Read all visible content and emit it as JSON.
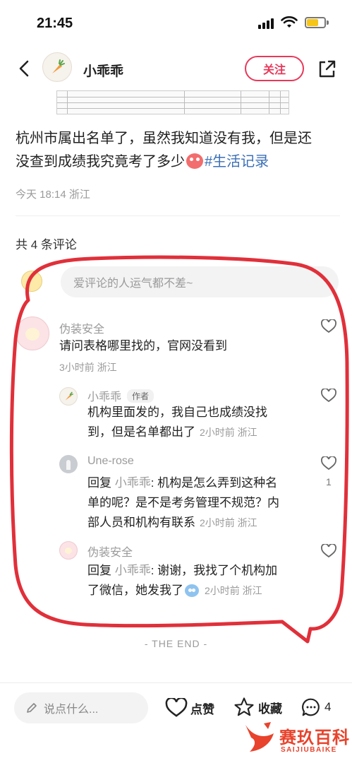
{
  "status_bar": {
    "time": "21:45"
  },
  "header": {
    "author_name": "小乖乖",
    "follow_label": "关注"
  },
  "post": {
    "text_line1": "杭州市属出名单了，虽然我知道没有我，但是还",
    "text_line2": "没查到成绩我究竟考了多少",
    "hashtag": "#生活记录",
    "meta": "今天 18:14 浙江"
  },
  "comments_section": {
    "count_label": "共 4 条评论",
    "input_placeholder": "爱评论的人运气都不差~"
  },
  "comments": [
    {
      "name": "伪装安全",
      "text": "请问表格哪里找的，官网没看到",
      "meta": "3小时前 浙江"
    },
    {
      "name": "小乖乖",
      "badge": "作者",
      "text_line1": "机构里面发的，我自己也成绩没找",
      "text_line2": "到，但是名单都出了",
      "meta": "2小时前 浙江"
    },
    {
      "name": "Une-rose",
      "reply_prefix": "回复 ",
      "reply_to": "小乖乖",
      "text_line1": ": 机构是怎么弄到这种名",
      "text_line2": "单的呢？是不是考务管理不规范？内",
      "text_line3": "部人员和机构有联系",
      "meta": "2小时前 浙江",
      "likes": "1"
    },
    {
      "name": "伪装安全",
      "reply_prefix": "回复 ",
      "reply_to": "小乖乖",
      "text_line1": ": 谢谢，我找了个机构加",
      "text_line2": "了微信，她发我了",
      "meta": "2小时前 浙江"
    }
  ],
  "end_label": "- THE END -",
  "bottom_bar": {
    "say_placeholder": "说点什么...",
    "like_label": "点赞",
    "collect_label": "收藏",
    "comment_count": "4"
  },
  "watermark": {
    "text": "赛玖百科",
    "sub": "SAIJIUBAIKE"
  },
  "colors": {
    "accent": "#e8385a",
    "hashtag": "#3b6fb6",
    "annotation": "#e0303a"
  },
  "icons": {
    "back": "chevron-left-icon",
    "share": "share-icon",
    "heart": "heart-icon",
    "star": "star-icon",
    "chat": "chat-bubble-icon",
    "pencil": "pencil-icon",
    "carrot": "carrot-icon"
  }
}
